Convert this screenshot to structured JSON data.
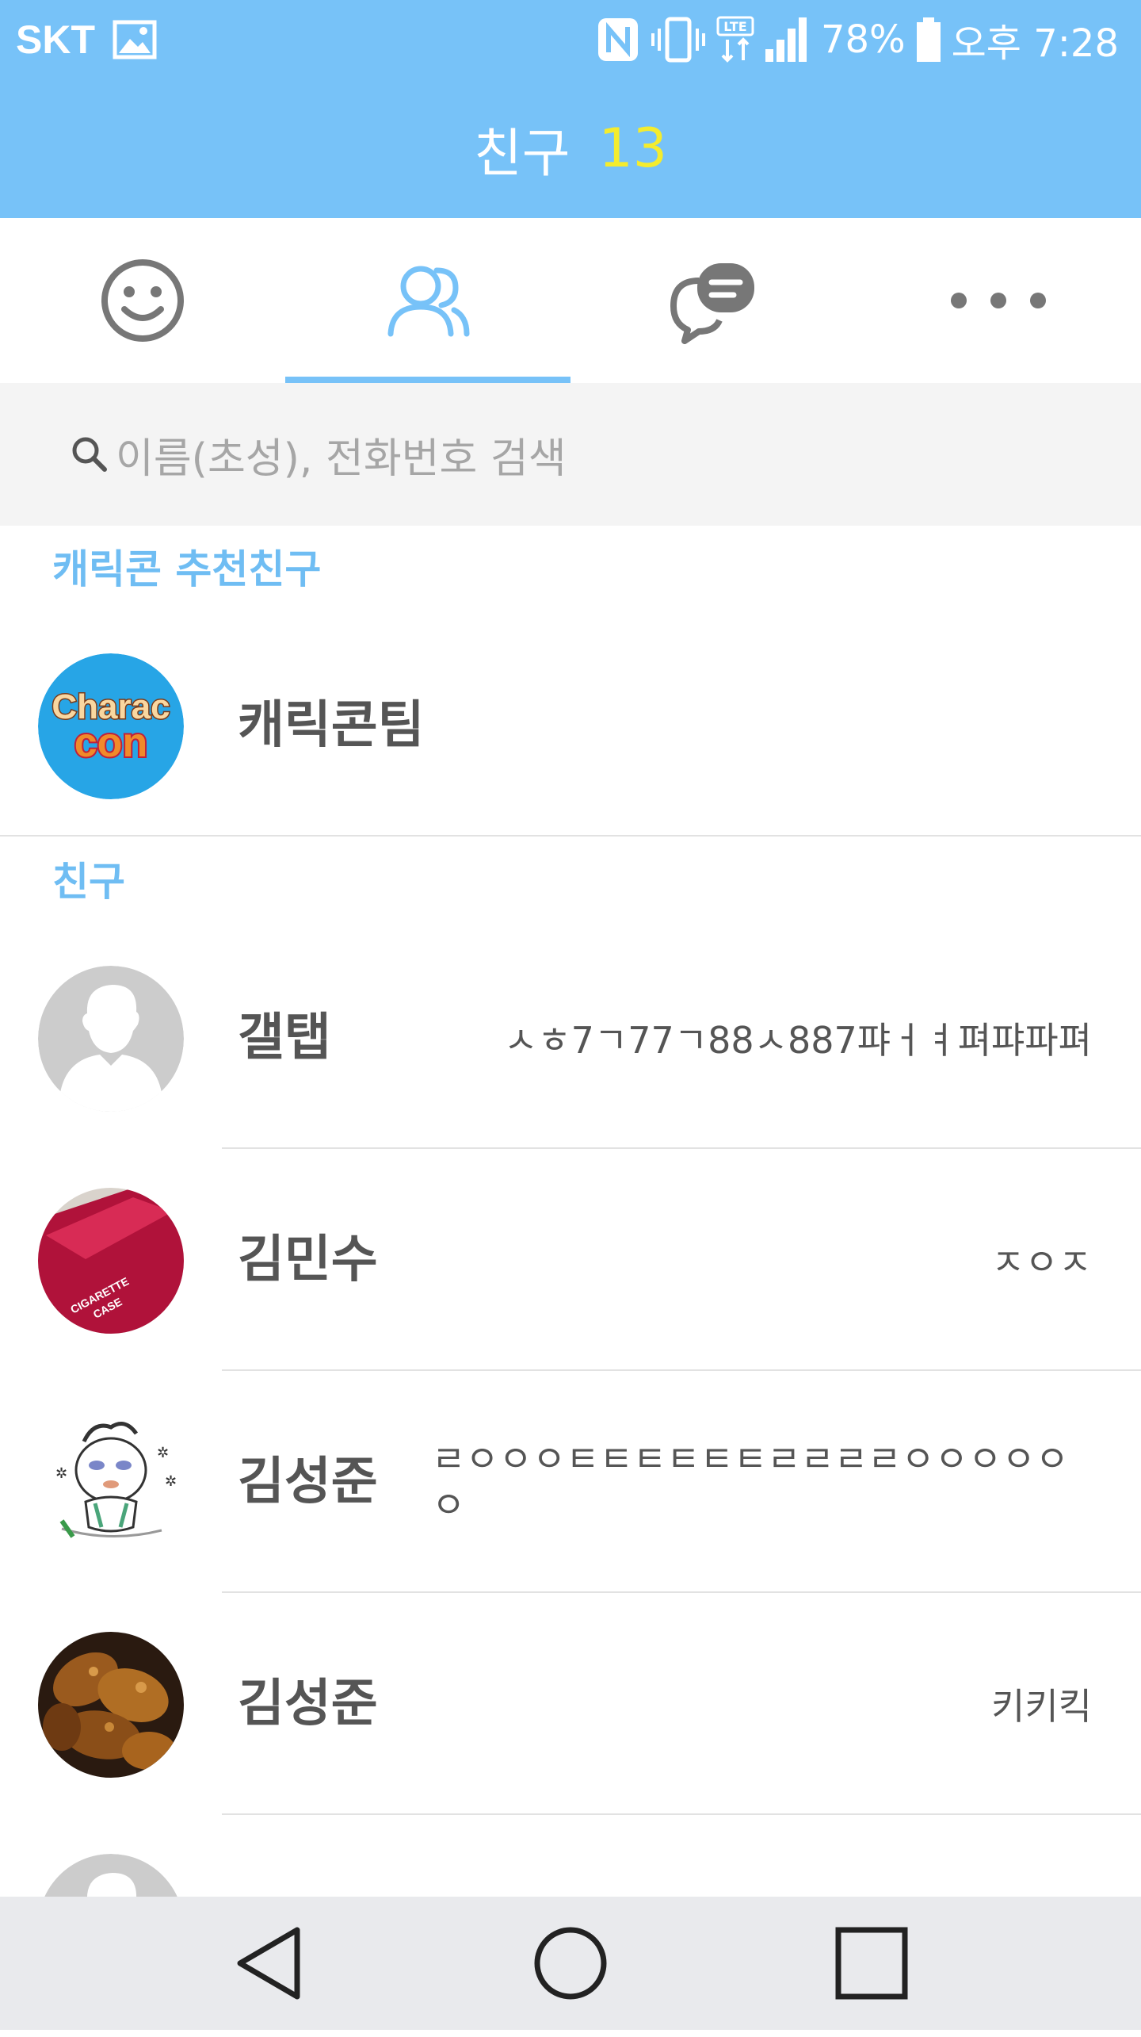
{
  "status_bar": {
    "carrier": "SKT",
    "battery": "78%",
    "time": "오후 7:28"
  },
  "header": {
    "title": "친구",
    "count": "13"
  },
  "tabs": [
    {
      "name": "emoticon",
      "icon": "smiley-icon"
    },
    {
      "name": "friends",
      "icon": "friends-icon",
      "active": true
    },
    {
      "name": "chats",
      "icon": "chat-bubbles-icon"
    },
    {
      "name": "more",
      "icon": "more-dots-icon"
    }
  ],
  "search": {
    "placeholder": "이름(초성), 전화번호 검색"
  },
  "sections": {
    "recommended": "캐릭콘 추천친구",
    "friends": "친구"
  },
  "recommended_friend": {
    "name": "캐릭콘팀",
    "logo_text_top": "Charac",
    "logo_text_bottom": "con"
  },
  "friends": [
    {
      "name": "갤탭",
      "status": "ㅅㅎ7ㄱ77ㄱ88ㅅ887퍄ㅓㅕ펴퍄파펴"
    },
    {
      "name": "김민수",
      "status": "ㅈㅇㅈ"
    },
    {
      "name": "김성준",
      "status": "ㄹㅇㅇㅇㅌㅌㅌㅌㅌㅌㄹㄹㄹㄹㅇㅇㅇㅇㅇㅇ"
    },
    {
      "name": "김성준",
      "status": "키키킥"
    }
  ],
  "colors": {
    "header_blue": "#77c2f8",
    "count_yellow": "#f4ec2e",
    "section_blue": "#6fbdf3"
  }
}
